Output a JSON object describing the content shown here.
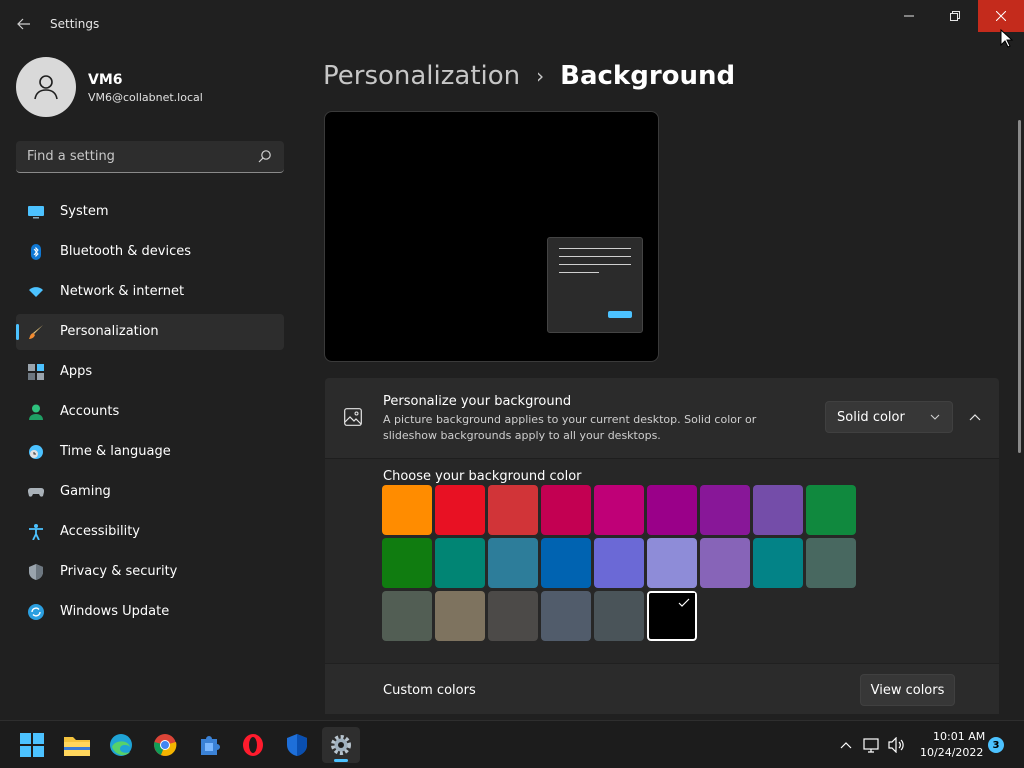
{
  "window": {
    "title": "Settings",
    "minimize_icon": "minimize-icon",
    "maximize_icon": "restore-icon",
    "close_icon": "close-icon"
  },
  "profile": {
    "name": "VM6",
    "email": "VM6@collabnet.local"
  },
  "search": {
    "placeholder": "Find a setting"
  },
  "sidebar": {
    "items": [
      {
        "label": "System",
        "icon": "monitor-icon"
      },
      {
        "label": "Bluetooth & devices",
        "icon": "bluetooth-icon"
      },
      {
        "label": "Network & internet",
        "icon": "wifi-icon"
      },
      {
        "label": "Personalization",
        "icon": "brush-icon",
        "active": true
      },
      {
        "label": "Apps",
        "icon": "apps-icon"
      },
      {
        "label": "Accounts",
        "icon": "person-icon"
      },
      {
        "label": "Time & language",
        "icon": "clock-globe-icon"
      },
      {
        "label": "Gaming",
        "icon": "gamepad-icon"
      },
      {
        "label": "Accessibility",
        "icon": "accessibility-icon"
      },
      {
        "label": "Privacy & security",
        "icon": "shield-icon"
      },
      {
        "label": "Windows Update",
        "icon": "update-icon"
      }
    ]
  },
  "breadcrumb": {
    "parent": "Personalization",
    "separator": "›",
    "current": "Background"
  },
  "background_setting": {
    "title": "Personalize your background",
    "description": "A picture background applies to your current desktop. Solid color or slideshow backgrounds apply to all your desktops.",
    "dropdown_value": "Solid color"
  },
  "color_panel": {
    "heading": "Choose your background color",
    "colors": [
      "#ff8c00",
      "#e81123",
      "#d13438",
      "#c30052",
      "#bf0077",
      "#9a0089",
      "#881798",
      "#744da9",
      "#10893e",
      "#107c10",
      "#018574",
      "#2d7d9a",
      "#0063b1",
      "#6b69d6",
      "#8e8cd8",
      "#8764b8",
      "#038387",
      "#486860",
      "#525e54",
      "#7e735f",
      "#4c4a48",
      "#515c6b",
      "#4a5459",
      "#000000"
    ],
    "selected_index": 23
  },
  "custom_colors": {
    "label": "Custom colors",
    "button": "View colors"
  },
  "taskbar": {
    "apps": [
      {
        "name": "start-button",
        "icon": "windows-logo-icon"
      },
      {
        "name": "file-explorer",
        "icon": "folder-icon"
      },
      {
        "name": "edge",
        "icon": "edge-icon"
      },
      {
        "name": "chrome",
        "icon": "chrome-icon"
      },
      {
        "name": "settings-ext",
        "icon": "puzzle-icon"
      },
      {
        "name": "opera",
        "icon": "opera-icon"
      },
      {
        "name": "defender",
        "icon": "shield-icon"
      },
      {
        "name": "settings",
        "icon": "gear-icon",
        "active": true
      }
    ],
    "time": "10:01 AM",
    "date": "10/24/2022",
    "notification_count": "3"
  }
}
